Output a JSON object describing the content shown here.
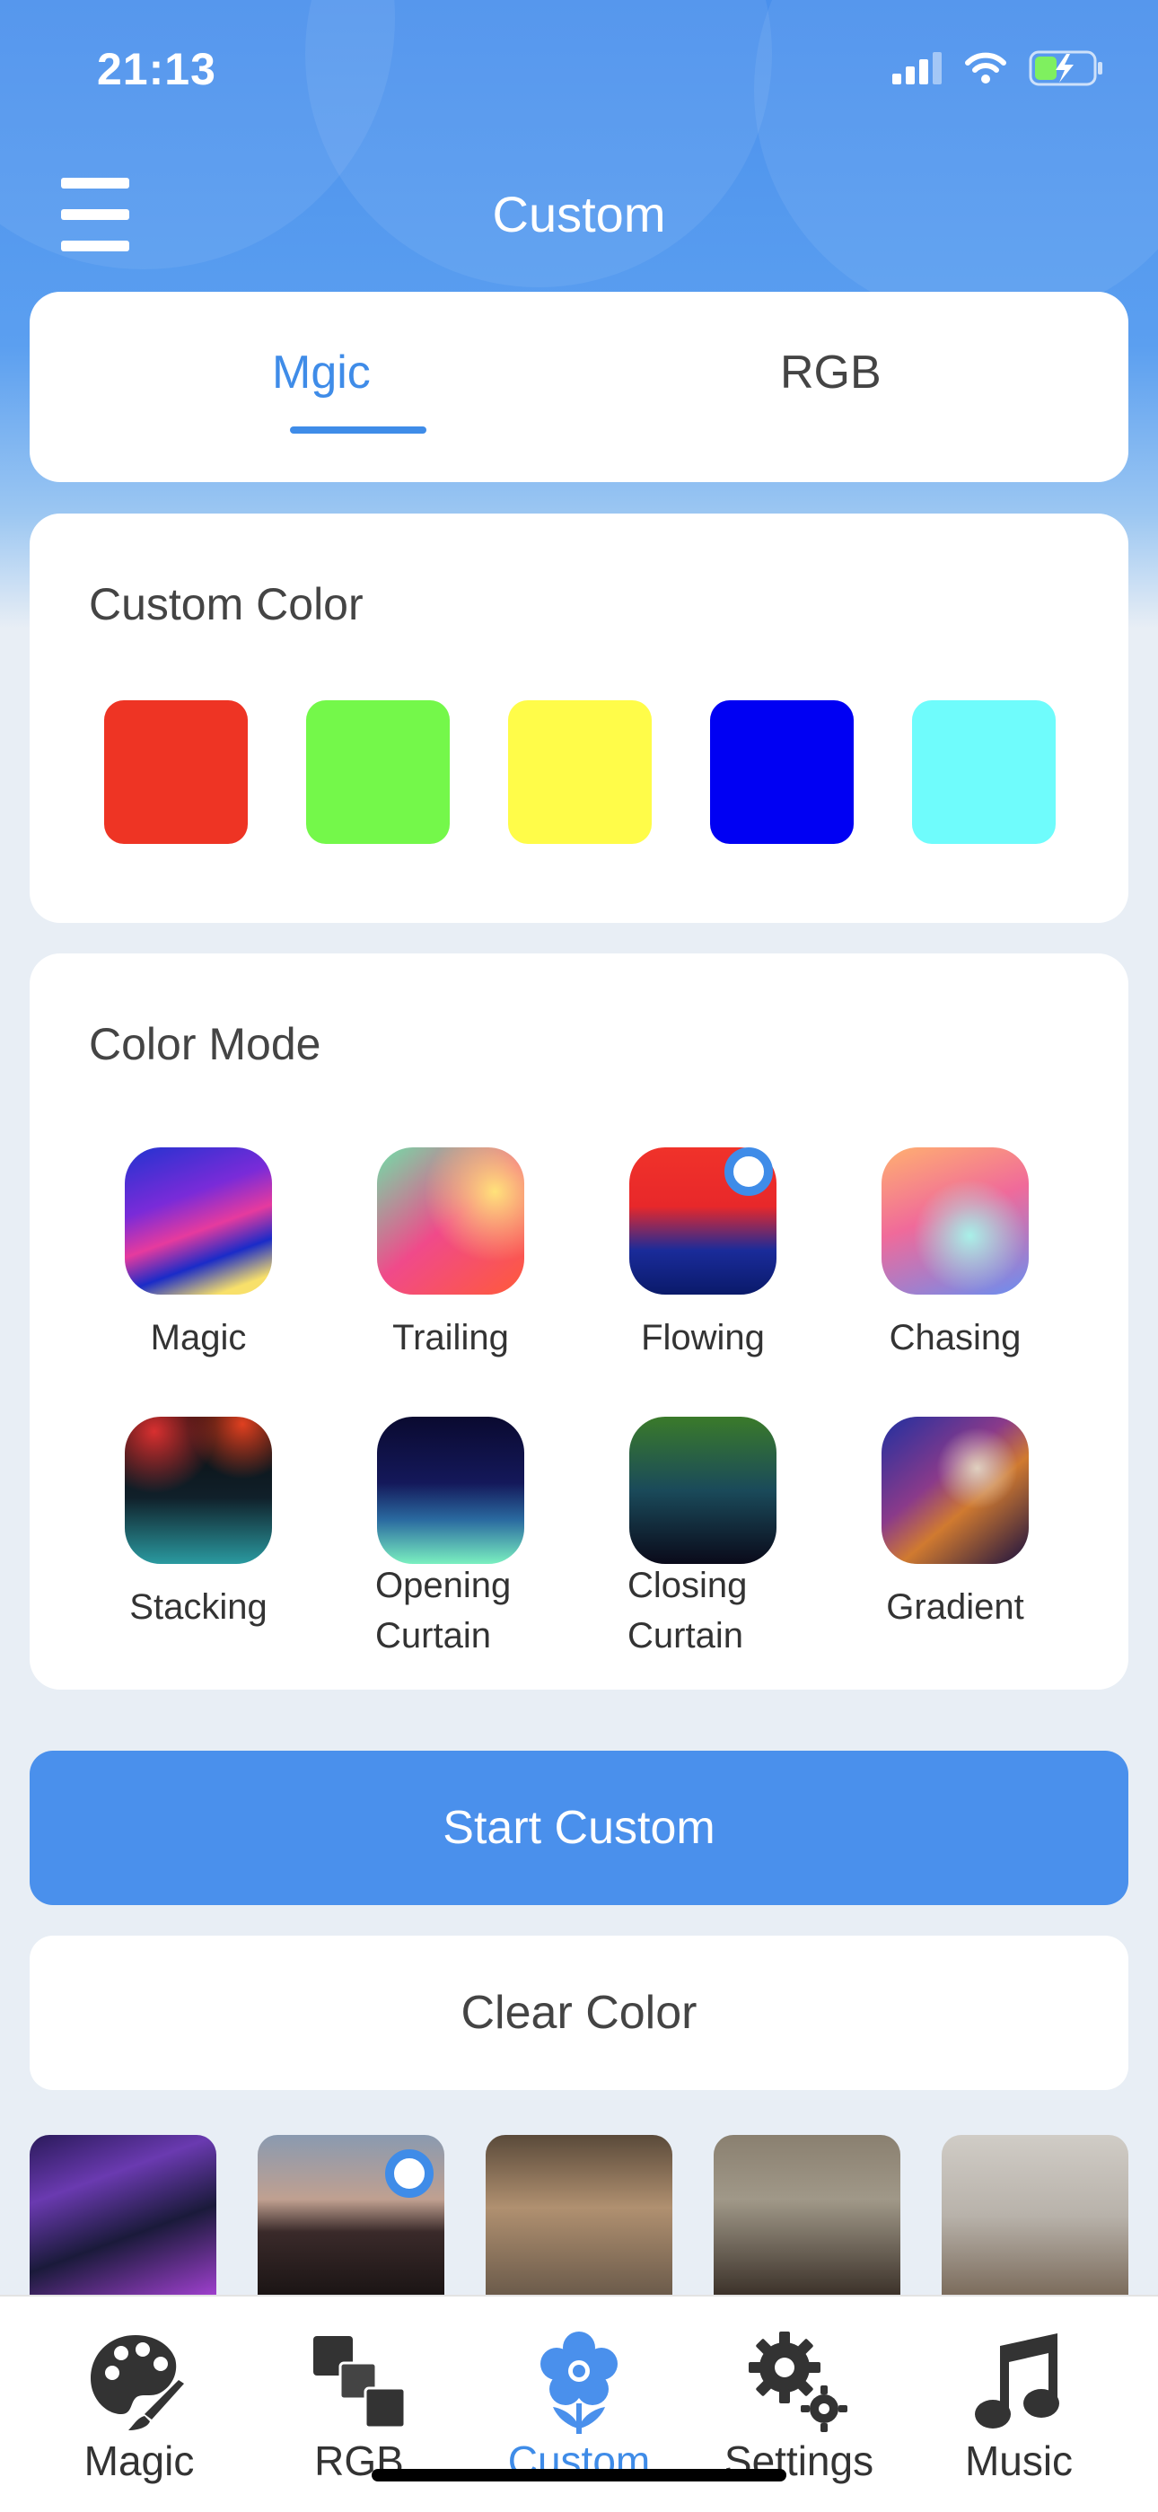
{
  "status_bar": {
    "time": "21:13"
  },
  "header": {
    "title": "Custom"
  },
  "tabs": [
    {
      "label": "Mgic",
      "active": true
    },
    {
      "label": "RGB",
      "active": false
    }
  ],
  "custom_color": {
    "title": "Custom Color",
    "swatches": [
      "#ee3424",
      "#74f84a",
      "#fffc49",
      "#0000f3",
      "#6ffcfc"
    ]
  },
  "color_mode": {
    "title": "Color Mode",
    "modes": [
      {
        "label": "Magic",
        "selected": false
      },
      {
        "label": "Trailing",
        "selected": false
      },
      {
        "label": "Flowing",
        "selected": true
      },
      {
        "label": "Chasing",
        "selected": false
      },
      {
        "label": "Stacking",
        "selected": false
      },
      {
        "label": "Opening Curtain",
        "line1": "Opening",
        "line2": "Curtain",
        "selected": false
      },
      {
        "label": "Closing Curtain",
        "line1": "Closing",
        "line2": "Curtain",
        "selected": false
      },
      {
        "label": "Gradient",
        "selected": false
      }
    ]
  },
  "actions": {
    "start": "Start Custom",
    "clear": "Clear Color"
  },
  "scenes": {
    "selected_index": 1
  },
  "tab_bar": [
    {
      "label": "Magic",
      "icon": "palette-icon"
    },
    {
      "label": "RGB",
      "icon": "rgb-squares-icon"
    },
    {
      "label": "Custom",
      "icon": "flower-icon",
      "active": true
    },
    {
      "label": "Settings",
      "icon": "gears-icon"
    },
    {
      "label": "Music",
      "icon": "music-note-icon"
    }
  ],
  "colors": {
    "accent": "#4a90ec",
    "header": "#4a90ec"
  }
}
